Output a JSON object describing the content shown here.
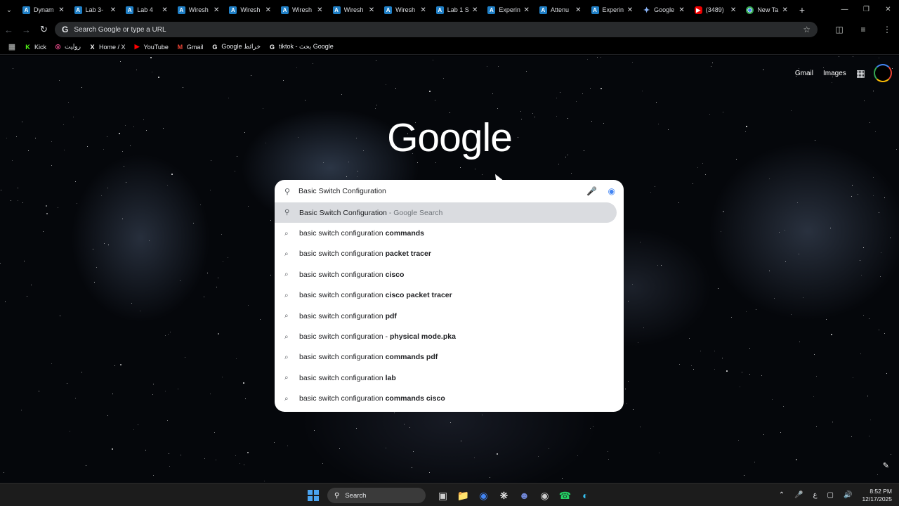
{
  "tabs": [
    {
      "title": "Dynam",
      "icon": "a"
    },
    {
      "title": "Lab 3-",
      "icon": "a"
    },
    {
      "title": "Lab 4 ",
      "icon": "a"
    },
    {
      "title": "Wiresh",
      "icon": "a"
    },
    {
      "title": "Wiresh",
      "icon": "a"
    },
    {
      "title": "Wiresh",
      "icon": "a"
    },
    {
      "title": "Wiresh",
      "icon": "a"
    },
    {
      "title": "Wiresh",
      "icon": "a"
    },
    {
      "title": "Lab 1 S",
      "icon": "a"
    },
    {
      "title": "Experin",
      "icon": "a"
    },
    {
      "title": "Attenu",
      "icon": "a"
    },
    {
      "title": "Experin",
      "icon": "a"
    },
    {
      "title": "Google",
      "icon": "gem"
    },
    {
      "title": "(3489)",
      "icon": "yt"
    },
    {
      "title": "New Ta",
      "icon": "chrome"
    }
  ],
  "toolbar": {
    "omnibox_placeholder": "Search Google or type a URL"
  },
  "bookmarks": [
    {
      "label": "Kick",
      "icon": "kick-icon"
    },
    {
      "label": "روليت",
      "icon": "roulette-icon"
    },
    {
      "label": "Home / X",
      "icon": "x-icon"
    },
    {
      "label": "YouTube",
      "icon": "youtube-icon"
    },
    {
      "label": "Gmail",
      "icon": "gmail-icon"
    },
    {
      "label": "Google خرائط",
      "icon": "google-icon"
    },
    {
      "label": "tiktok - بحث Google",
      "icon": "google-icon"
    }
  ],
  "page": {
    "gmail_link": "Gmail",
    "images_link": "Images",
    "logo": "Google"
  },
  "search": {
    "query": "Basic Switch Configuration",
    "first_suggestion": {
      "text": "Basic Switch Configuration",
      "suffix": " - Google Search"
    },
    "suggestions": [
      {
        "base": "basic switch configuration ",
        "bold": "commands"
      },
      {
        "base": "basic switch configuration ",
        "bold": "packet tracer"
      },
      {
        "base": "basic switch configuration ",
        "bold": "cisco"
      },
      {
        "base": "basic switch configuration ",
        "bold": "cisco packet tracer"
      },
      {
        "base": "basic switch configuration ",
        "bold": "pdf"
      },
      {
        "base": "basic switch configuration - ",
        "bold": "physical mode.pka"
      },
      {
        "base": "basic switch configuration ",
        "bold": "commands pdf"
      },
      {
        "base": "basic switch configuration ",
        "bold": "lab"
      },
      {
        "base": "basic switch configuration ",
        "bold": "commands cisco"
      }
    ]
  },
  "taskbar": {
    "search_label": "Search",
    "language": "ع",
    "time": "8:52 PM",
    "date": "12/17/2025"
  }
}
